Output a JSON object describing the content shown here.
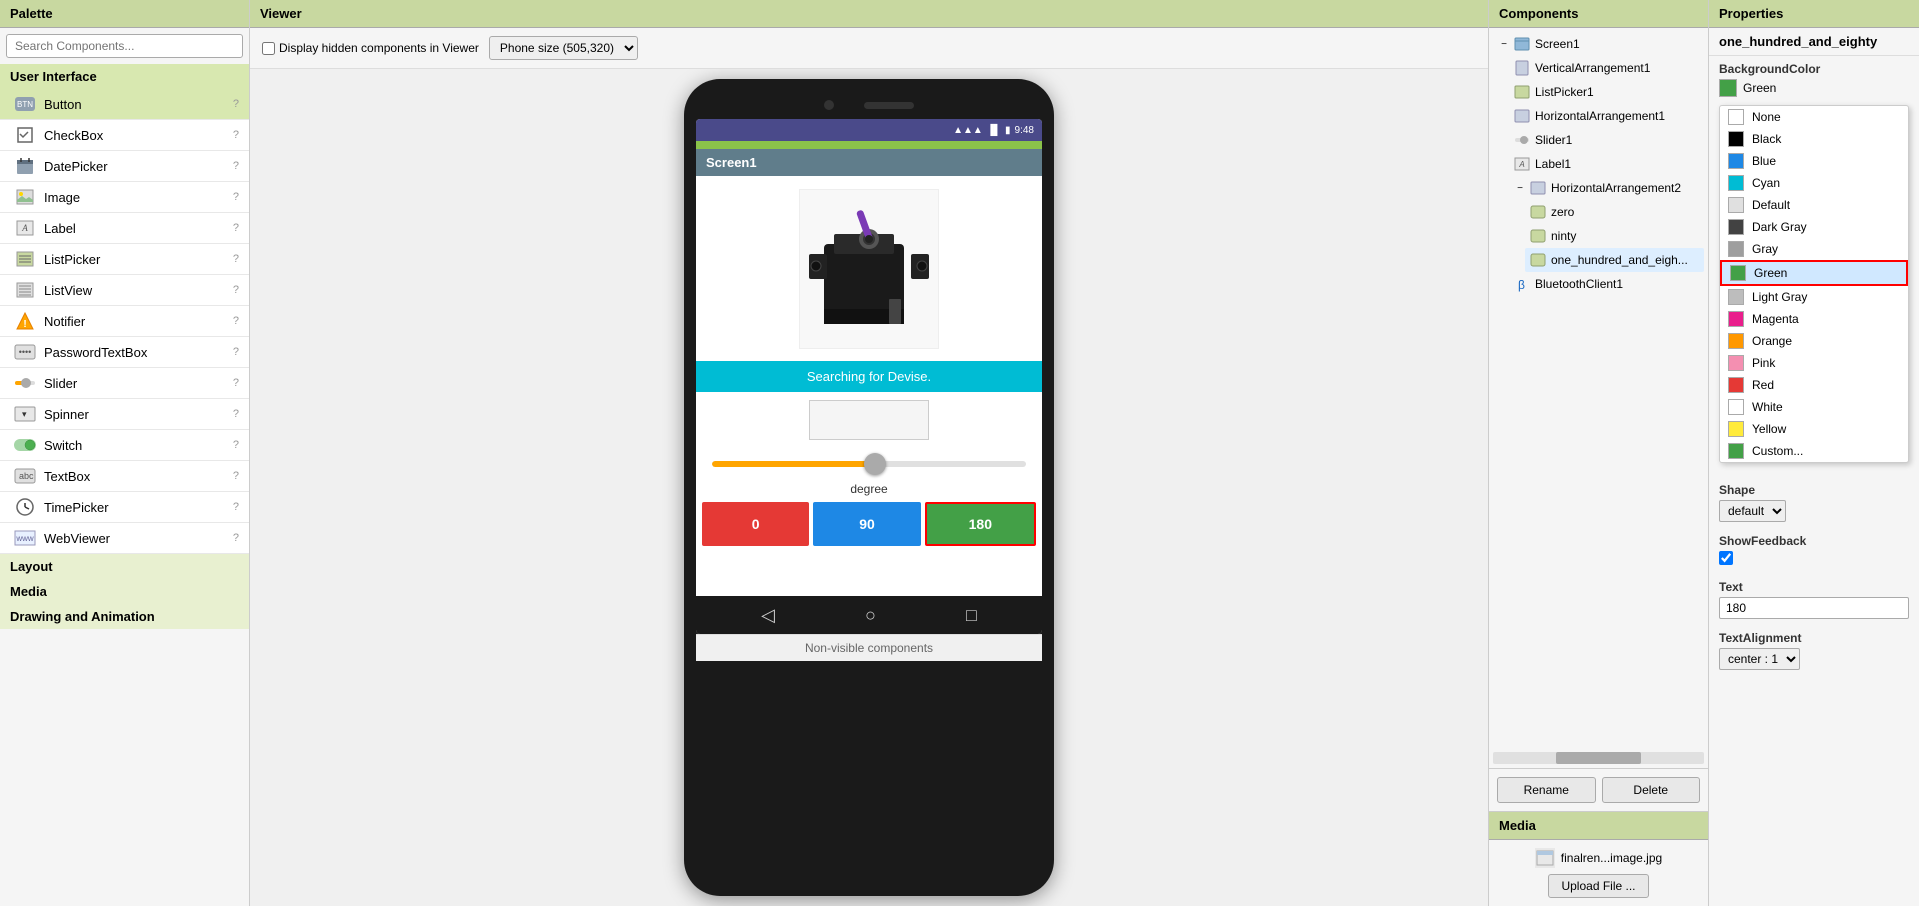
{
  "palette": {
    "title": "Palette",
    "search_placeholder": "Search Components...",
    "sections": [
      {
        "name": "User Interface",
        "items": [
          {
            "label": "Button",
            "selected": true
          },
          {
            "label": "CheckBox"
          },
          {
            "label": "DatePicker"
          },
          {
            "label": "Image"
          },
          {
            "label": "Label"
          },
          {
            "label": "ListPicker"
          },
          {
            "label": "ListView"
          },
          {
            "label": "Notifier"
          },
          {
            "label": "PasswordTextBox"
          },
          {
            "label": "Slider"
          },
          {
            "label": "Spinner"
          },
          {
            "label": "Switch"
          },
          {
            "label": "TextBox"
          },
          {
            "label": "TimePicker"
          },
          {
            "label": "WebViewer"
          }
        ]
      },
      {
        "name": "Layout"
      },
      {
        "name": "Media"
      },
      {
        "name": "Drawing and Animation"
      }
    ]
  },
  "viewer": {
    "title": "Viewer",
    "display_hidden_label": "Display hidden components in Viewer",
    "phone_size_label": "Phone size (505,320)",
    "screen_title": "Screen1",
    "status_time": "9:48",
    "searching_text": "Searching for Devise.",
    "degree_label": "degree",
    "btn_0": "0",
    "btn_90": "90",
    "btn_180": "180",
    "non_visible_label": "Non-visible components"
  },
  "components": {
    "title": "Components",
    "tree": [
      {
        "label": "Screen1",
        "level": 0,
        "collapsible": true,
        "collapsed": false
      },
      {
        "label": "VerticalArrangement1",
        "level": 1,
        "collapsible": false
      },
      {
        "label": "ListPicker1",
        "level": 1,
        "collapsible": false
      },
      {
        "label": "HorizontalArrangement1",
        "level": 1,
        "collapsible": false
      },
      {
        "label": "Slider1",
        "level": 1,
        "collapsible": false
      },
      {
        "label": "Label1",
        "level": 1,
        "collapsible": false
      },
      {
        "label": "HorizontalArrangement2",
        "level": 1,
        "collapsible": true,
        "collapsed": false
      },
      {
        "label": "zero",
        "level": 2,
        "collapsible": false
      },
      {
        "label": "ninty",
        "level": 2,
        "collapsible": false
      },
      {
        "label": "one_hundred_and_eigh...",
        "level": 2,
        "collapsible": false
      },
      {
        "label": "BluetoothClient1",
        "level": 1,
        "collapsible": false
      }
    ],
    "rename_label": "Rename",
    "delete_label": "Delete",
    "media_title": "Media",
    "media_file": "finalren...image.jpg",
    "upload_label": "Upload File ..."
  },
  "properties": {
    "title": "Properties",
    "component_name": "one_hundred_and_eighty",
    "bg_color_label": "BackgroundColor",
    "bg_color_value": "Green",
    "bg_color_swatch": "#43a047",
    "shape_label": "Shape",
    "shape_value": "default",
    "show_feedback_label": "ShowFeedback",
    "show_feedback_checked": true,
    "text_label": "Text",
    "text_value": "180",
    "text_alignment_label": "TextAlignment",
    "text_alignment_value": "center : 1",
    "color_options": [
      {
        "label": "None",
        "swatch": "transparent",
        "border": true
      },
      {
        "label": "Black",
        "swatch": "#000000"
      },
      {
        "label": "Blue",
        "swatch": "#1e88e5"
      },
      {
        "label": "Cyan",
        "swatch": "#00bcd4"
      },
      {
        "label": "Default",
        "swatch": "#e0e0e0"
      },
      {
        "label": "Dark Gray",
        "swatch": "#424242"
      },
      {
        "label": "Gray",
        "swatch": "#9e9e9e"
      },
      {
        "label": "Green",
        "swatch": "#43a047",
        "selected": true
      },
      {
        "label": "Light Gray",
        "swatch": "#bdbdbd"
      },
      {
        "label": "Magenta",
        "swatch": "#e91e8c"
      },
      {
        "label": "Orange",
        "swatch": "#ff9800"
      },
      {
        "label": "Pink",
        "swatch": "#f48fb1"
      },
      {
        "label": "Red",
        "swatch": "#e53935"
      },
      {
        "label": "White",
        "swatch": "#ffffff",
        "border": true
      },
      {
        "label": "Yellow",
        "swatch": "#ffeb3b"
      },
      {
        "label": "Custom...",
        "swatch": "#43a047"
      }
    ]
  },
  "icons": {
    "collapse": "▼",
    "expand": "▶",
    "collapse_minus": "−",
    "wifi": "📶",
    "battery": "🔋",
    "back": "◁",
    "home": "○",
    "recent": "□",
    "check": "✓",
    "image_icon": "🖼",
    "bluetooth_icon": "⚡"
  }
}
